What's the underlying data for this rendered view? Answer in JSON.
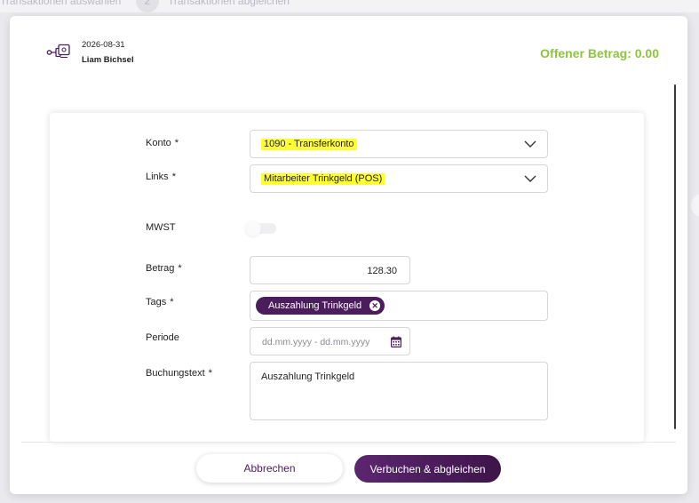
{
  "background": {
    "step1_label": "Transaktionen auswählen",
    "step2_number": "2",
    "step2_label": "Transaktionen abgleichen"
  },
  "header": {
    "icon": "transfer-account-icon",
    "date": "2026-08-31",
    "name": "Liam Bichsel",
    "open_amount": "Offener Betrag: 0.00"
  },
  "form": {
    "konto": {
      "label": "Konto",
      "required": "*",
      "value": "1090 - Transferkonto"
    },
    "links": {
      "label": "Links",
      "required": "*",
      "value": "Mitarbeiter Trinkgeld (POS)"
    },
    "mwst": {
      "label": "MWST",
      "enabled": false
    },
    "betrag": {
      "label": "Betrag",
      "required": "*",
      "value": "128.30"
    },
    "tags": {
      "label": "Tags",
      "required": "*",
      "items": [
        "Auszahlung Trinkgeld"
      ]
    },
    "periode": {
      "label": "Periode",
      "placeholder": "dd.mm.yyyy - dd.mm.yyyy"
    },
    "buchungstext": {
      "label": "Buchungstext",
      "required": "*",
      "value": "Auszahlung Trinkgeld"
    }
  },
  "footer": {
    "cancel_label": "Abbrechen",
    "submit_label": "Verbuchen & abgleichen"
  },
  "colors": {
    "accent": "#4b1d5c",
    "open_amount": "#8cc63f",
    "highlight": "#ffff33"
  }
}
